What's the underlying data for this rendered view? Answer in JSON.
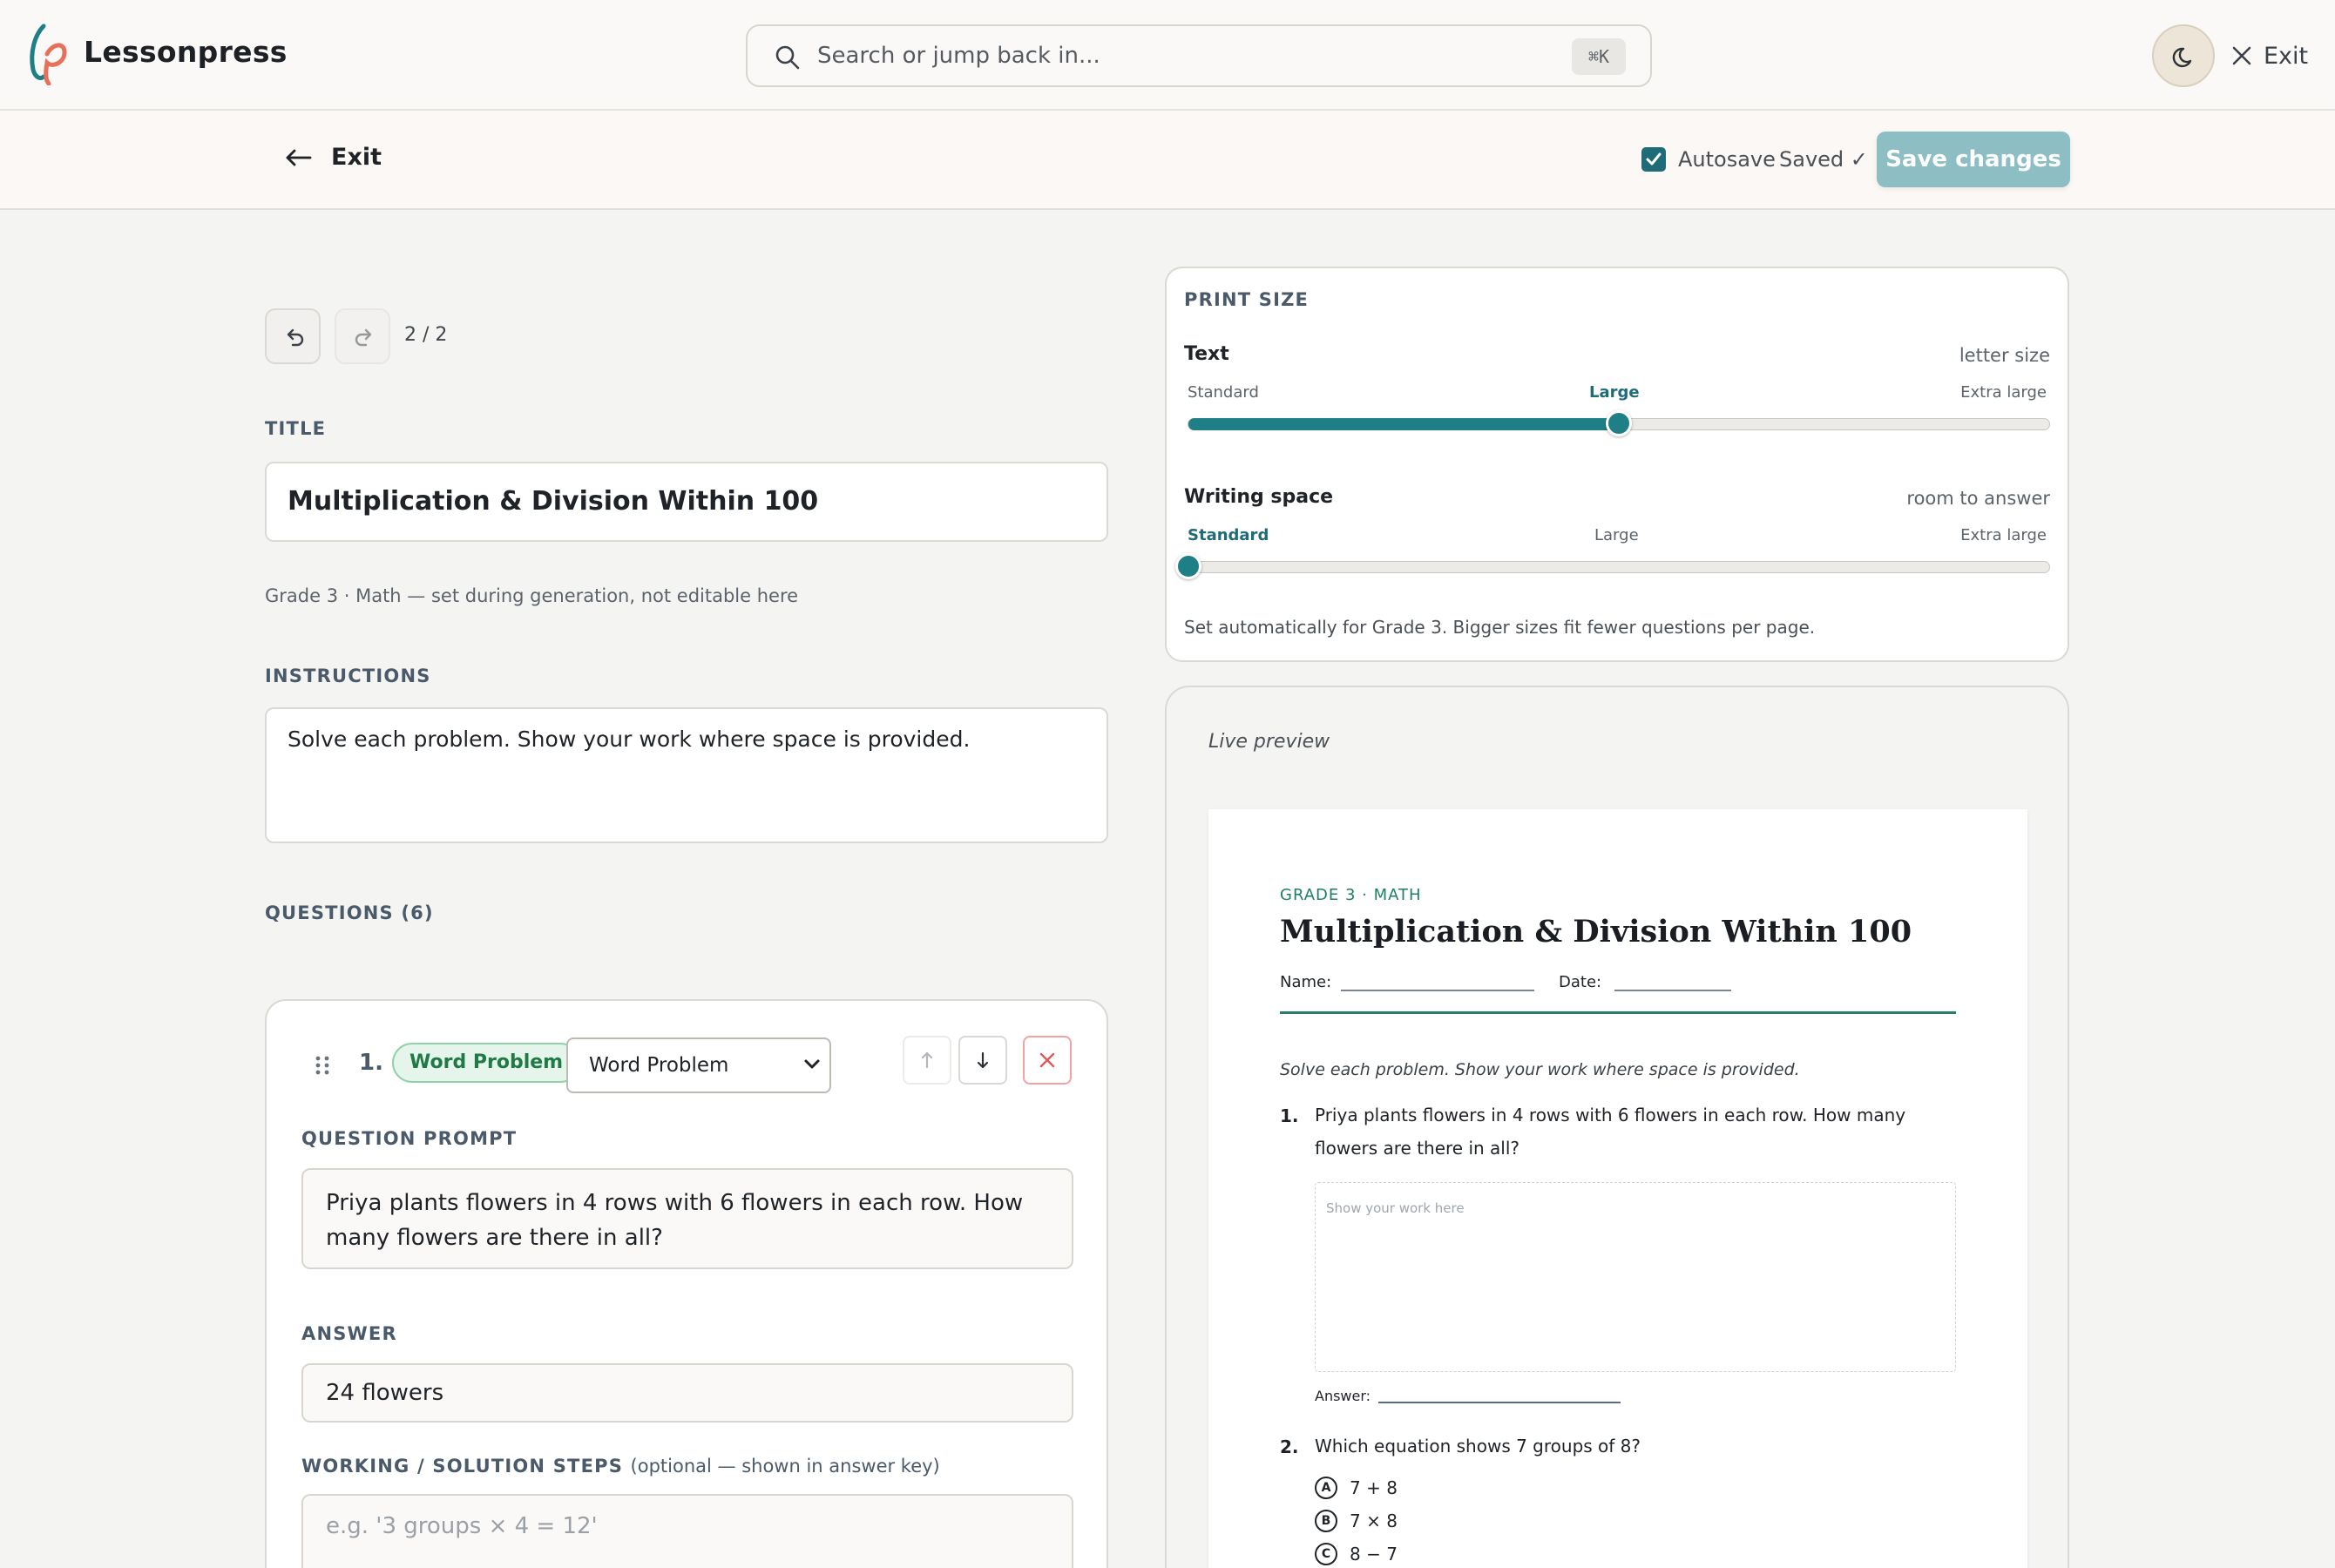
{
  "app": {
    "name": "Lessonpress"
  },
  "search": {
    "placeholder": "Search or jump back in...",
    "shortcut": "⌘K"
  },
  "topnav": {
    "exit_label": "Exit",
    "theme_icon": "moon-icon"
  },
  "subbar": {
    "exit_label": "Exit",
    "autosave_label": "Autosave",
    "autosave_checked": true,
    "saved_label": "Saved ✓",
    "save_button": "Save changes"
  },
  "history": {
    "position": "2 / 2"
  },
  "editor": {
    "title_label": "TITLE",
    "title_value": "Multiplication & Division Within 100",
    "meta_note": "Grade 3 · Math — set during generation, not editable here",
    "instructions_label": "INSTRUCTIONS",
    "instructions_value": "Solve each problem. Show your work where space is provided.",
    "questions_label": "QUESTIONS (6)"
  },
  "question": {
    "number": "1.",
    "type_badge": "Word Problem",
    "type_select": "Word Problem",
    "prompt_label": "QUESTION PROMPT",
    "prompt_value": "Priya plants flowers in 4 rows with 6 flowers in each row. How many flowers are there in all?",
    "answer_label": "ANSWER",
    "answer_value": "24 flowers",
    "working_label": "WORKING / SOLUTION STEPS",
    "working_hint": "(optional — shown in answer key)",
    "working_placeholder": "e.g. '3 groups × 4 = 12'"
  },
  "print_size": {
    "title": "PRINT SIZE",
    "text": {
      "label": "Text",
      "hint": "letter size",
      "options": [
        "Standard",
        "Large",
        "Extra large"
      ],
      "selected_index": 1,
      "value_fraction": 0.5
    },
    "writing": {
      "label": "Writing space",
      "hint": "room to answer",
      "options": [
        "Standard",
        "Large",
        "Extra large"
      ],
      "selected_index": 0,
      "value_fraction": 0.0
    },
    "note": "Set automatically for Grade 3. Bigger sizes fit fewer questions per page."
  },
  "preview": {
    "label": "Live preview",
    "eyebrow": "GRADE 3 · MATH",
    "title": "Multiplication & Division Within 100",
    "name_label": "Name:",
    "date_label": "Date:",
    "instructions": "Solve each problem. Show your work where space is provided.",
    "q1": {
      "num": "1.",
      "text": "Priya plants flowers in 4 rows with 6 flowers in each row. How many flowers are there in all?",
      "work_hint": "Show your work here",
      "answer_label": "Answer:"
    },
    "q2": {
      "num": "2.",
      "text": "Which equation shows 7 groups of 8?",
      "choices": [
        {
          "letter": "A",
          "text": "7 + 8"
        },
        {
          "letter": "B",
          "text": "7 × 8"
        },
        {
          "letter": "C",
          "text": "8 − 7"
        }
      ]
    }
  },
  "colors": {
    "accent": "#1f7f86",
    "save_button": "#8dbec4",
    "badge_green": "#1f7a46",
    "delete_red": "#e05a5a"
  }
}
